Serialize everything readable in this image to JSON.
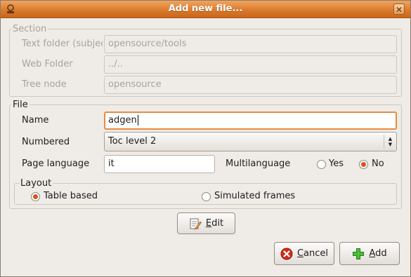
{
  "window": {
    "title": "Add new file..."
  },
  "section": {
    "legend": "Section",
    "text_folder_label": "Text folder (subjec",
    "text_folder_value": "opensource/tools",
    "web_folder_label": "Web Folder",
    "web_folder_value": "../..",
    "tree_node_label": "Tree node",
    "tree_node_value": "opensource"
  },
  "file": {
    "legend": "File",
    "name_label": "Name",
    "name_value": "adgen",
    "numbered_label": "Numbered",
    "numbered_value": "Toc level 2",
    "page_language_label": "Page language",
    "page_language_value": "it",
    "multilanguage_label": "Multilanguage",
    "multilanguage_yes": "Yes",
    "multilanguage_no": "No",
    "multilanguage_selected": "No"
  },
  "layout": {
    "legend": "Layout",
    "table_based": "Table based",
    "simulated_frames": "Simulated frames",
    "selected": "Table based"
  },
  "buttons": {
    "edit_first": "E",
    "edit_rest": "dit",
    "cancel_first": "C",
    "cancel_rest": "ancel",
    "add_first": "A",
    "add_rest": "dd"
  },
  "colors": {
    "accent": "#d9782a",
    "radio_dot": "#d9531e",
    "focus": "#e98b3e"
  }
}
